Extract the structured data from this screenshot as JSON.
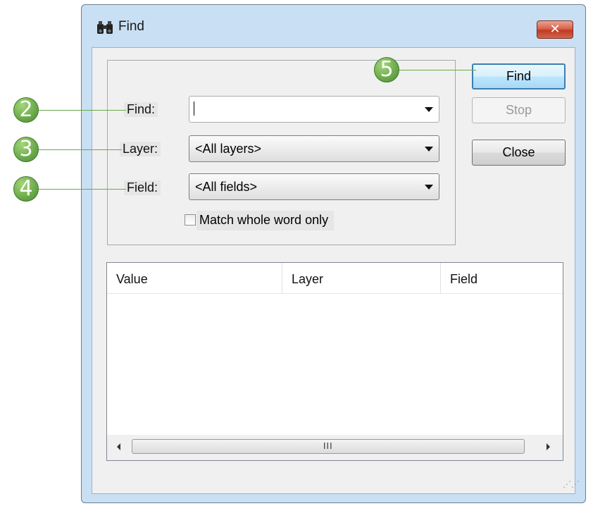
{
  "window": {
    "title": "Find",
    "icon": "binoculars-icon",
    "close_glyph": "✕"
  },
  "search": {
    "find_label": "Find:",
    "find_value": "",
    "layer_label": "Layer:",
    "layer_value": "<All layers>",
    "field_label": "Field:",
    "field_value": "<All fields>",
    "match_whole_word_label": "Match whole word only",
    "match_whole_word_checked": false
  },
  "buttons": {
    "find": "Find",
    "stop": "Stop",
    "close": "Close"
  },
  "results": {
    "columns": [
      "Value",
      "Layer",
      "Field"
    ],
    "rows": [],
    "scroll_grip": "III"
  },
  "callouts": [
    "2",
    "3",
    "4",
    "5"
  ],
  "colors": {
    "callout_green": "#6aa94a",
    "window_frame": "#c9dff3",
    "close_red": "#c13a22",
    "default_button_border": "#3c7fb1"
  }
}
